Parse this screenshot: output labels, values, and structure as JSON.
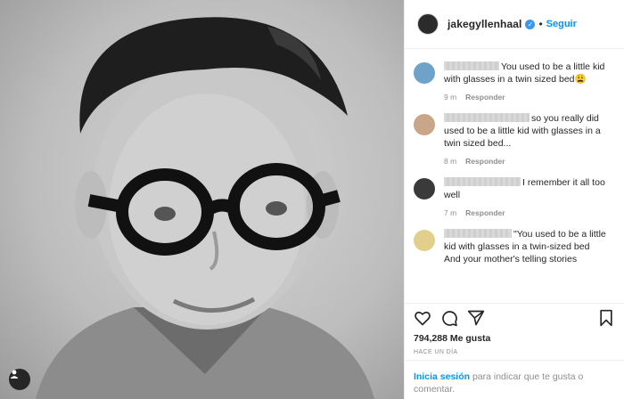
{
  "photo": {
    "alt_subject": "portrait"
  },
  "header": {
    "username": "jakegyllenhaal",
    "separator": "•",
    "follow_label": "Seguir"
  },
  "comments": [
    {
      "text": "You used to be a little kid with glasses in a twin sized bed😩",
      "time": "9 m",
      "reply": "Responder",
      "avatar_color": "#6fa2c9"
    },
    {
      "text": "so you really did used to be a little kid with glasses in a twin sized bed...",
      "time": "8 m",
      "reply": "Responder",
      "avatar_color": "#c9a58a"
    },
    {
      "text": "I remember it all too well",
      "time": "7 m",
      "reply": "Responder",
      "avatar_color": "#3a3a3a"
    },
    {
      "text": "\"You used to be a little kid with glasses in a twin-sized bed",
      "text2": "And your mother's telling stories",
      "time": "",
      "reply": "",
      "avatar_color": "#e3cf8c"
    }
  ],
  "actions": {
    "like_icon": "heart-icon",
    "comment_icon": "comment-icon",
    "share_icon": "share-icon",
    "save_icon": "bookmark-icon"
  },
  "likes": {
    "label": "794,288 Me gusta"
  },
  "timestamp": "HACE UN DÍA",
  "login": {
    "link": "Inicia sesión",
    "rest": "para indicar que te gusta o comentar."
  },
  "colors": {
    "accent": "#0095f6",
    "verified": "#3897f0",
    "muted": "#8e8e8e"
  }
}
